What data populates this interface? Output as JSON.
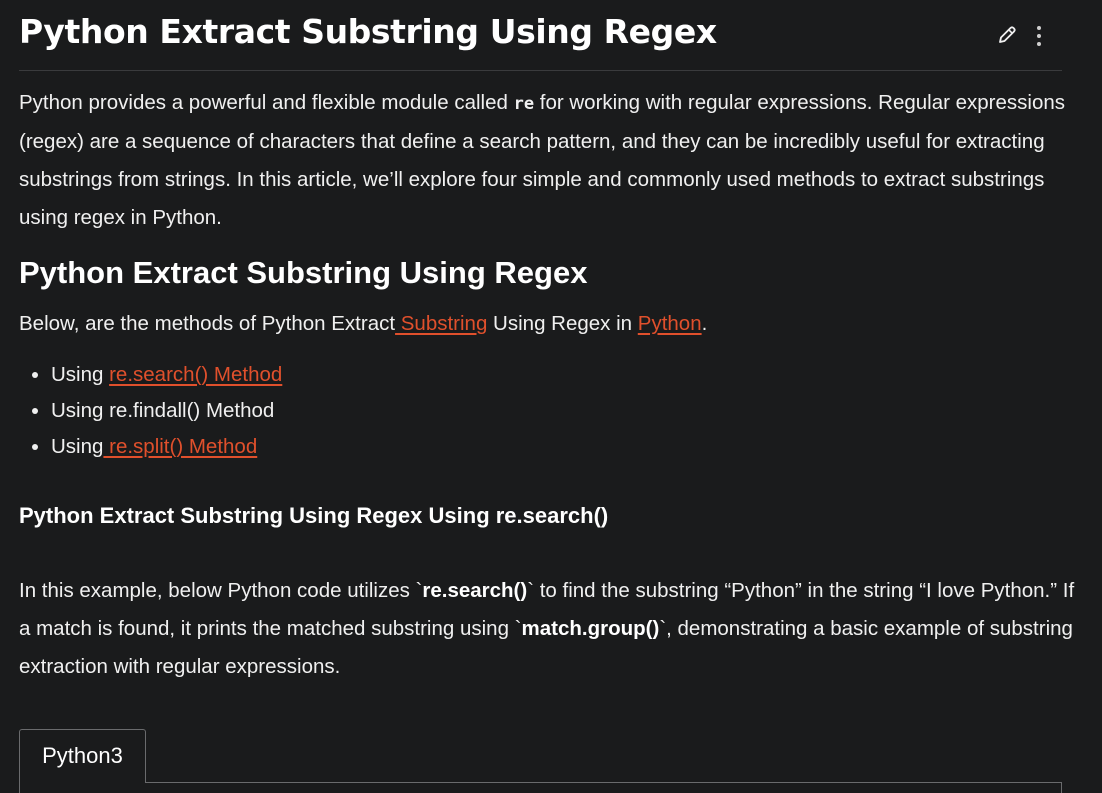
{
  "header": {
    "title": "Python Extract Substring Using Regex",
    "edit_icon": "pencil-icon",
    "more_icon": "vertical-dots-icon"
  },
  "intro": {
    "part1": "Python provides a powerful and flexible module called ",
    "code": "re",
    "part2": " for working with regular expressions. Regular expressions (regex) are a sequence of characters that define a search pattern, and they can be incredibly useful for extracting substrings from strings. In this article, we’ll explore four simple and commonly used methods to extract substrings using regex in Python."
  },
  "section": {
    "heading": "Python Extract Substring Using Regex",
    "below_part1": "Below, are the methods of Python Extract",
    "below_link1": " Substring",
    "below_part2": " Using Regex in ",
    "below_link2": "Python",
    "below_part3": "."
  },
  "methods": [
    {
      "prefix": "Using ",
      "link": "re.search() Method",
      "plain": ""
    },
    {
      "prefix": "Using re.findall() Method",
      "link": "",
      "plain": ""
    },
    {
      "prefix": "Using",
      "link": " re.split() Method",
      "plain": ""
    }
  ],
  "subsection": {
    "heading": "Python Extract Substring Using Regex Using re.search()",
    "p1": "In this example, below Python code utilizes `",
    "b1": "re.search()",
    "p2": "` to find the substring “Python” in the string “I love Python.” If a match is found, it prints the matched substring using `",
    "b2": "match.group()",
    "p3": "`, demonstrating a basic example of substring extraction with regular expressions."
  },
  "code_block": {
    "tab_label": "Python3"
  },
  "colors": {
    "background": "#1a1b1c",
    "link": "#e0502c",
    "text": "#f0f0f0"
  }
}
